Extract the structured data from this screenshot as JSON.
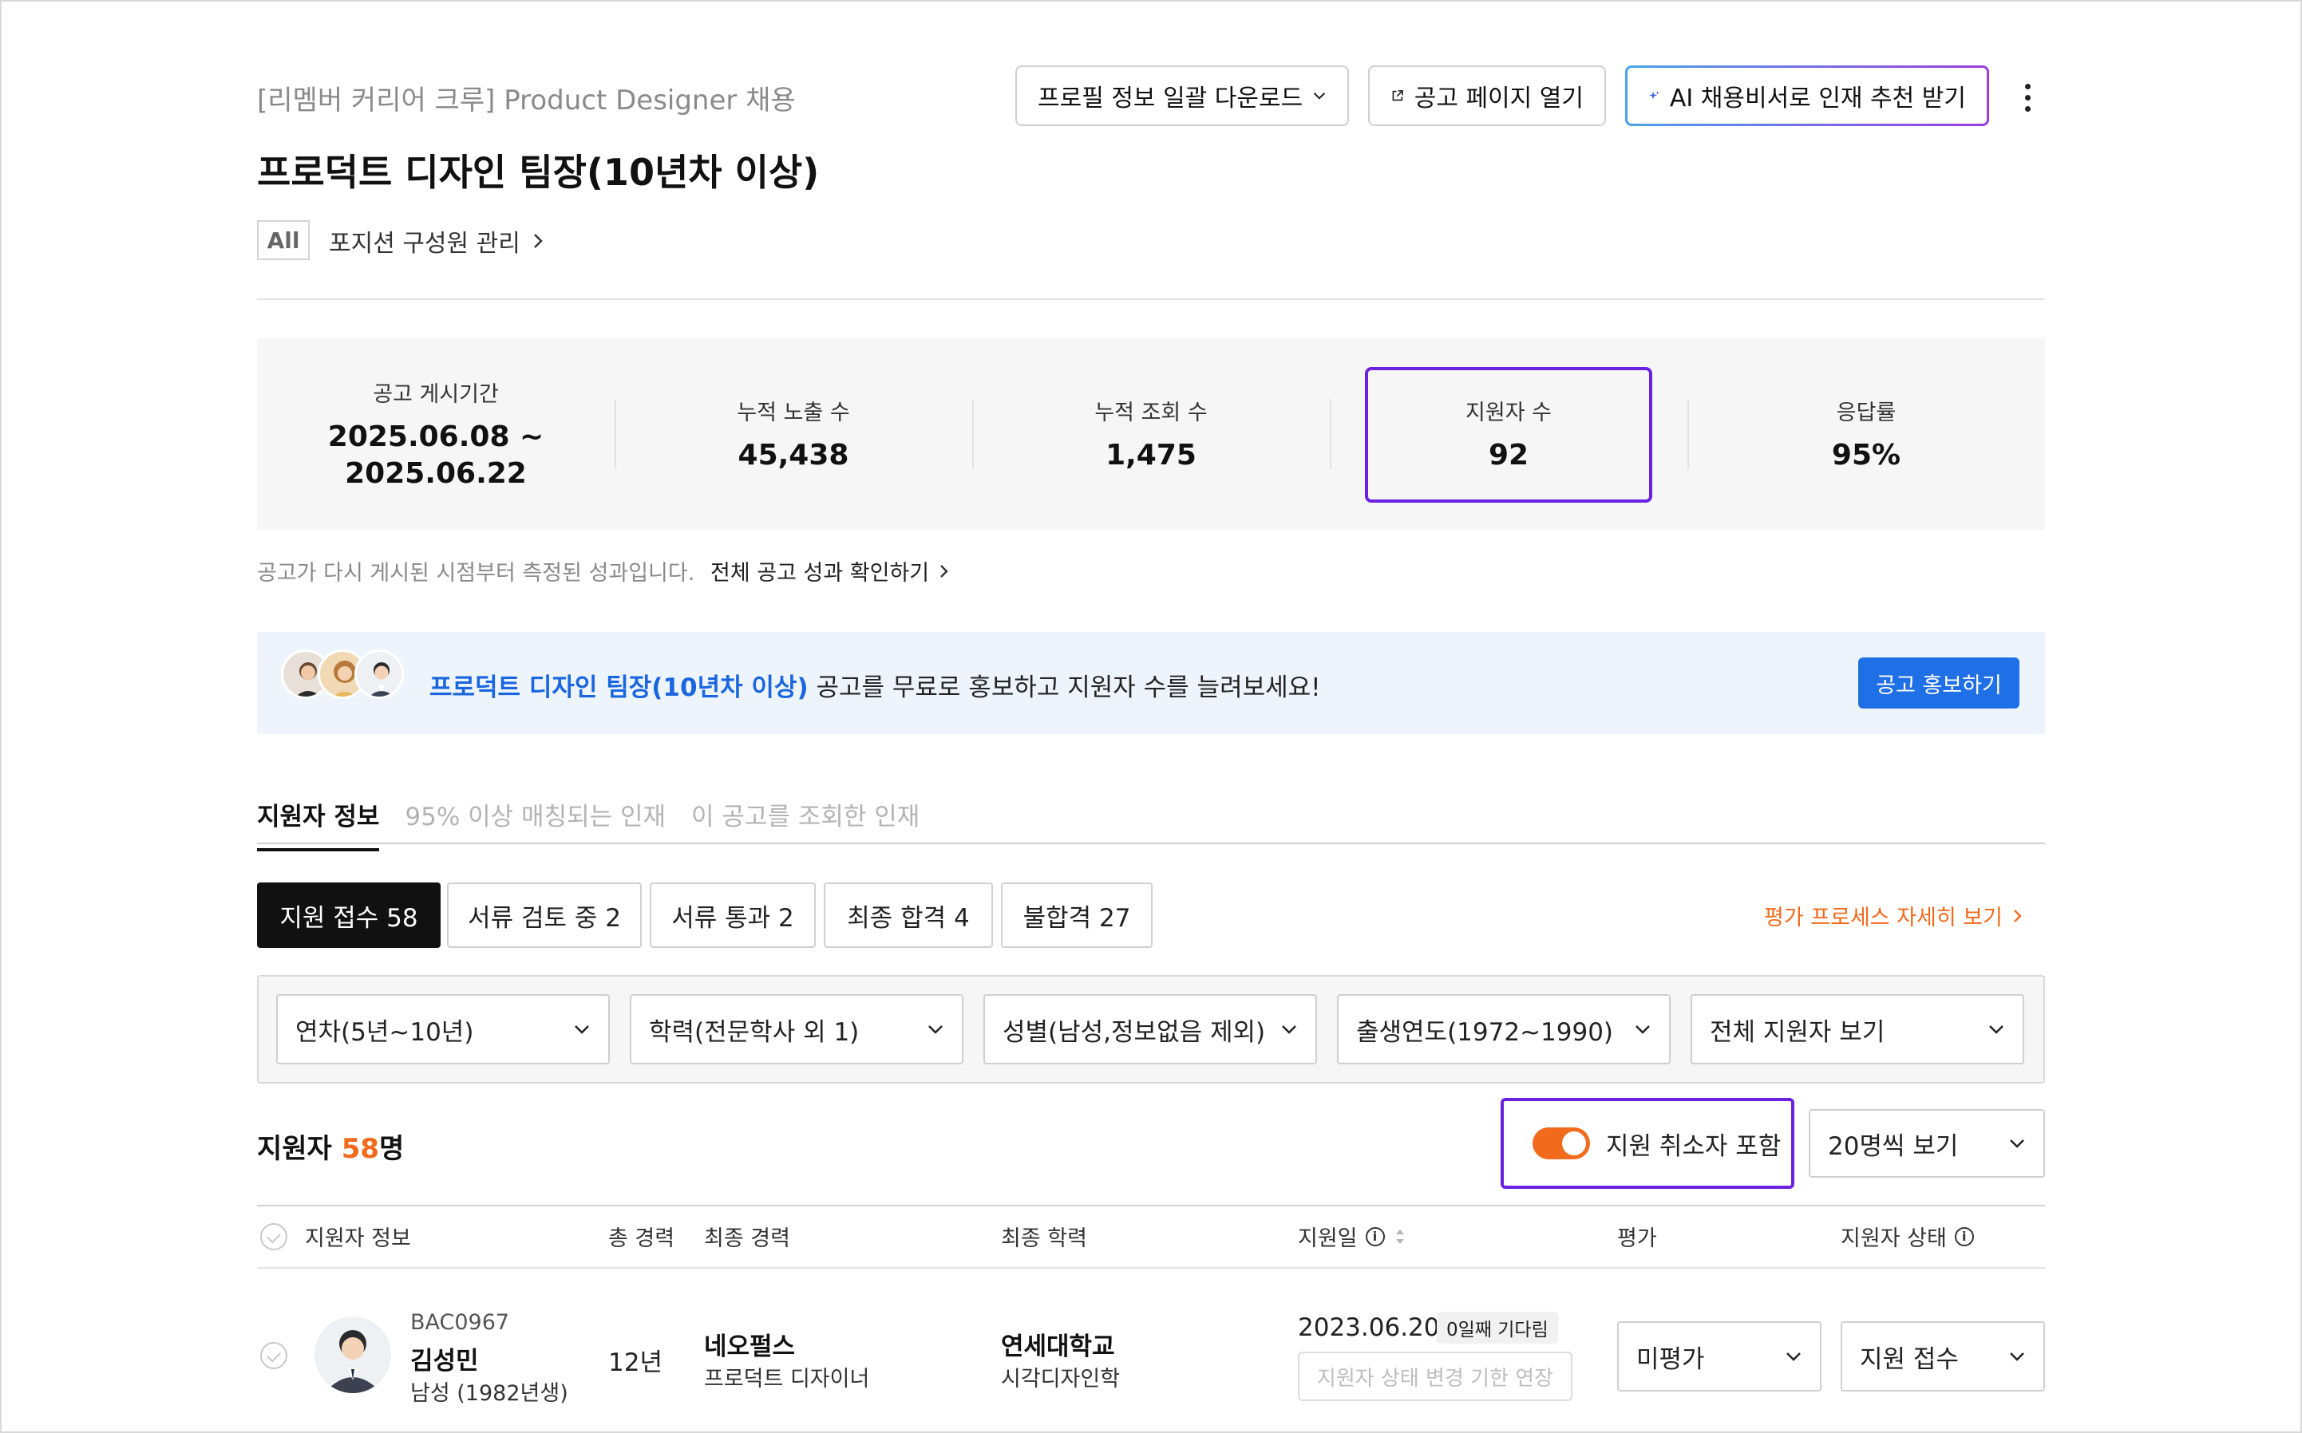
{
  "header": {
    "subtitle": "[리멤버 커리어 크루] Product Designer 채용",
    "title": "프로덕트 디자인 팀장(10년차 이상)",
    "all_badge": "All",
    "position_link": "포지션 구성원 관리",
    "buttons": {
      "download": "프로필 정보 일괄 다운로드",
      "open_page": "공고 페이지 열기",
      "ai_recommend": "AI 채용비서로 인재 추천 받기"
    }
  },
  "stats": {
    "items": [
      {
        "label": "공고 게시기간",
        "value": "2025.06.08 ~",
        "value2": "2025.06.22"
      },
      {
        "label": "누적 노출 수",
        "value": "45,438"
      },
      {
        "label": "누적 조회 수",
        "value": "1,475"
      },
      {
        "label": "지원자 수",
        "value": "92"
      },
      {
        "label": "응답률",
        "value": "95%"
      }
    ],
    "note": "공고가 다시 게시된 시점부터 측정된 성과입니다.",
    "all_link": "전체 공고 성과 확인하기"
  },
  "promo": {
    "highlight": "프로덕트 디자인 팀장(10년차 이상)",
    "text": " 공고를 무료로 홍보하고 지원자 수를 늘려보세요!",
    "button": "공고 홍보하기"
  },
  "tabs": [
    {
      "label": "지원자 정보",
      "active": true
    },
    {
      "label": "95% 이상 매칭되는 인재",
      "active": false
    },
    {
      "label": "이 공고를 조회한 인재",
      "active": false
    }
  ],
  "status_chips": [
    {
      "label": "지원 접수 58",
      "active": true
    },
    {
      "label": "서류 검토 중 2",
      "active": false
    },
    {
      "label": "서류 통과 2",
      "active": false
    },
    {
      "label": "최종 합격 4",
      "active": false
    },
    {
      "label": "불합격 27",
      "active": false
    }
  ],
  "process_link": "평가 프로세스 자세히 보기",
  "filters": [
    "연차(5년~10년)",
    "학력(전문학사 외 1)",
    "성별(남성,정보없음 제외)",
    "출생연도(1972~1990)",
    "전체 지원자 보기"
  ],
  "count": {
    "prefix": "지원자 ",
    "num": "58",
    "suffix": "명"
  },
  "toggle": {
    "label": "지원 취소자 포함",
    "on": true
  },
  "per_page": "20명씩 보기",
  "table": {
    "headers": {
      "info": "지원자 정보",
      "total_career": "총 경력",
      "last_career": "최종 경력",
      "last_edu": "최종 학력",
      "apply_date": "지원일",
      "evaluation": "평가",
      "status": "지원자 상태"
    },
    "rows": [
      {
        "id": "BAC0967",
        "name": "김성민",
        "meta": "남성 (1982년생)",
        "total_career": "12년",
        "company": "네오펄스",
        "job": "프로덕트 디자이너",
        "school": "연세대학교",
        "major": "시각디자인학",
        "apply_date": "2023.06.20",
        "wait_badge": "0일째 기다림",
        "extend_button": "지원자 상태 변경 기한 연장",
        "evaluation": "미평가",
        "status": "지원 접수"
      }
    ]
  },
  "colors": {
    "accent_purple": "#6a22e0",
    "accent_orange": "#f26a1b",
    "accent_blue": "#1f6fe6",
    "promo_bg": "#eef4fc"
  }
}
